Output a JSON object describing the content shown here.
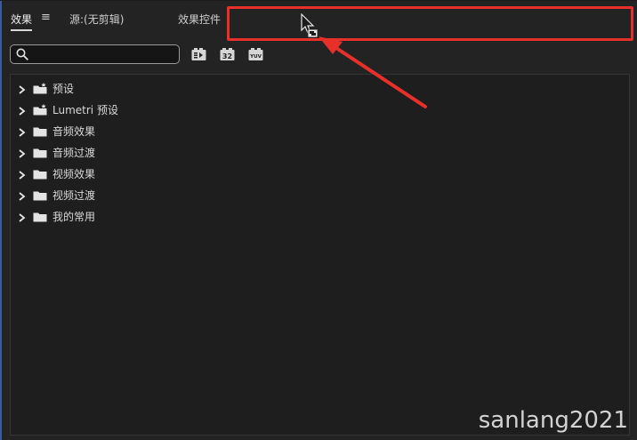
{
  "tabs": {
    "effects": "效果",
    "menu_glyph": "≡",
    "source": "源:(无剪辑)",
    "effect_controls": "效果控件"
  },
  "search": {
    "value": "",
    "placeholder": ""
  },
  "filters": {
    "accelerated": "accelerated-effects-icon",
    "bit32": "32",
    "yuv": "YUV"
  },
  "tree": [
    {
      "label": "预设",
      "icon": "preset-folder-icon"
    },
    {
      "label": "Lumetri 预设",
      "icon": "preset-folder-icon"
    },
    {
      "label": "音频效果",
      "icon": "folder-icon"
    },
    {
      "label": "音频过渡",
      "icon": "folder-icon"
    },
    {
      "label": "视频效果",
      "icon": "folder-icon"
    },
    {
      "label": "视频过渡",
      "icon": "folder-icon"
    },
    {
      "label": "我的常用",
      "icon": "folder-icon"
    }
  ],
  "annotation": {
    "color": "#e8302a"
  },
  "watermark": "sanlang2021"
}
